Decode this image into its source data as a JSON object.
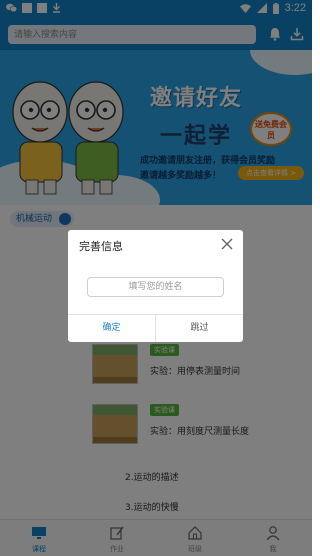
{
  "status_bar": {
    "time": "3:22"
  },
  "search": {
    "placeholder": "请输入搜索内容"
  },
  "banner": {
    "title": "邀请好友",
    "title2": "一起学",
    "badge": "送免费会员",
    "line1": "成功邀请朋友注册，获得会员奖励",
    "line2": "邀请越多奖励越多！",
    "cta": "点击查看详情 >"
  },
  "chip": {
    "label": "机械运动"
  },
  "lessons": [
    {
      "tag": "实验课",
      "title": "实验：用停表测量时间"
    },
    {
      "tag": "实验课",
      "title": "实验：用刻度尺测量长度"
    }
  ],
  "sections": [
    "2.运动的描述",
    "3.运动的快慢"
  ],
  "tabs": [
    {
      "label": "课程"
    },
    {
      "label": "作业"
    },
    {
      "label": "班级"
    },
    {
      "label": "我"
    }
  ],
  "dialog": {
    "title": "完善信息",
    "input_placeholder": "填写您的姓名",
    "confirm_label": "确定",
    "cancel_label": "跳过"
  },
  "colors": {
    "primary": "#1282c8",
    "banner": "#2aa2e6",
    "tag_green": "#56b43c",
    "dialog_confirm": "#1a7fd4"
  }
}
